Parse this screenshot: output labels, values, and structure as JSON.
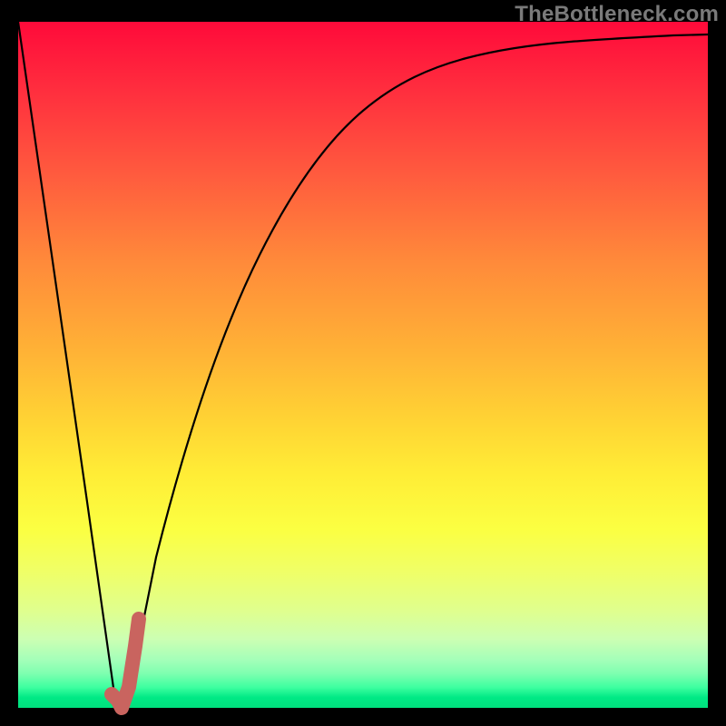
{
  "watermark": "TheBottleneck.com",
  "colors": {
    "background": "#000000",
    "gradient_top": "#ff0a3a",
    "gradient_bottom": "#00e07d",
    "curve": "#000000",
    "highlight": "#c9645f"
  },
  "chart_data": {
    "type": "line",
    "title": "",
    "xlabel": "",
    "ylabel": "",
    "xlim": [
      0,
      100
    ],
    "ylim": [
      0,
      100
    ],
    "series": [
      {
        "name": "bottleneck-curve",
        "x": [
          0,
          5,
          10,
          12,
          14,
          15,
          16,
          18,
          20,
          25,
          30,
          35,
          40,
          50,
          60,
          70,
          80,
          90,
          100
        ],
        "values": [
          100,
          65,
          30,
          16,
          2,
          0,
          3,
          12,
          22,
          42,
          56,
          66,
          73,
          82,
          87,
          91,
          93,
          95,
          96
        ]
      },
      {
        "name": "highlight-segment",
        "x": [
          13.5,
          14.5,
          15,
          16,
          17,
          17.5
        ],
        "values": [
          2,
          1,
          0,
          3,
          9,
          13
        ]
      }
    ]
  }
}
